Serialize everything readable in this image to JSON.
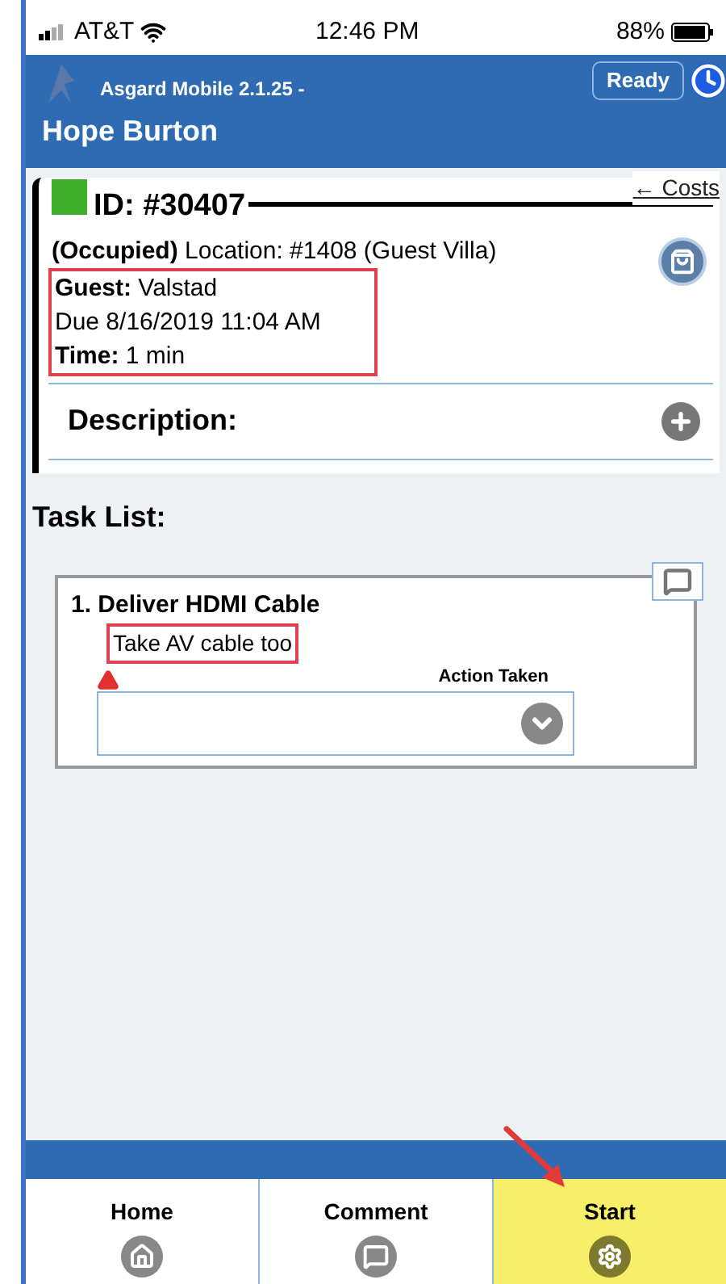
{
  "status_bar": {
    "carrier": "AT&T",
    "time": "12:46 PM",
    "battery": "88%"
  },
  "header": {
    "app_version": "Asgard Mobile 2.1.25 -",
    "status_button": "Ready",
    "user_name": "Hope Burton"
  },
  "work_order": {
    "id": "ID: #30407",
    "color": "#3fae2a",
    "costs_link": "← Costs",
    "lines": [
      {
        "label": "(Occupied)",
        "value": " Location: #1408 (Guest Villa)",
        "highlighted": false
      },
      {
        "label": "Guest:",
        "value": " Valstad",
        "highlighted": true
      },
      {
        "value": "Due 8/16/2019 11:04 AM",
        "highlighted": true
      },
      {
        "label": "Time:",
        "value": " 1 min",
        "highlighted": true
      }
    ],
    "description_label": "Description:"
  },
  "task_list": {
    "heading": "Task List:",
    "tasks": [
      {
        "title": "1. Deliver HDMI Cable",
        "note": "Take AV cable too",
        "note_highlighted": true,
        "warning": true,
        "action_label": "Action Taken"
      }
    ]
  },
  "nav_tabs": [
    {
      "label": "Home",
      "selected": false
    },
    {
      "label": "Comment",
      "selected": false
    },
    {
      "label": "Start",
      "selected": true
    }
  ]
}
